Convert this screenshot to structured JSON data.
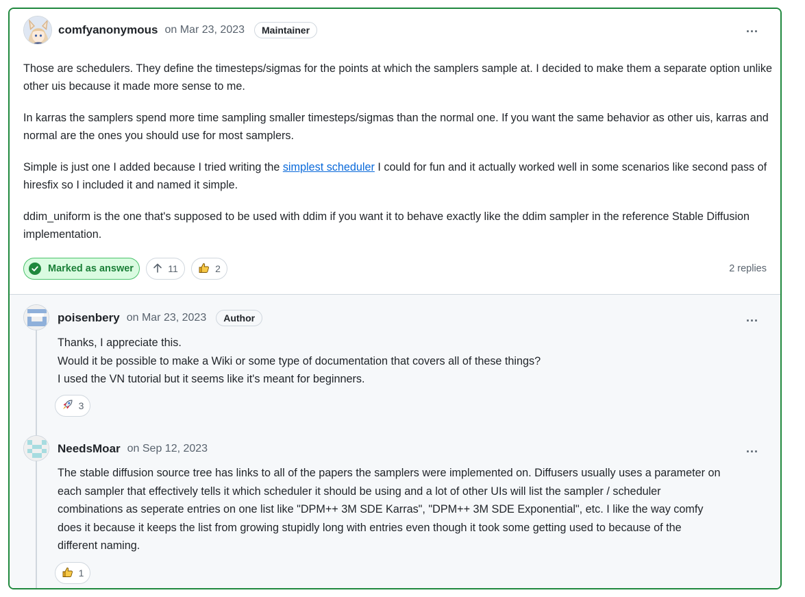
{
  "main_comment": {
    "author": "comfyanonymous",
    "date": "on Mar 23, 2023",
    "role_badge": "Maintainer",
    "paragraphs": {
      "p1": "Those are schedulers. They define the timesteps/sigmas for the points at which the samplers sample at. I decided to make them a separate option unlike other uis because it made more sense to me.",
      "p2": "In karras the samplers spend more time sampling smaller timesteps/sigmas than the normal one. If you want the same behavior as other uis, karras and normal are the ones you should use for most samplers.",
      "p3_before": "Simple is just one I added because I tried writing the ",
      "p3_link": "simplest scheduler",
      "p3_after": " I could for fun and it actually worked well in some scenarios like second pass of hiresfix so I included it and named it simple.",
      "p4": "ddim_uniform is the one that's supposed to be used with ddim if you want it to behave exactly like the ddim sampler in the reference Stable Diffusion implementation."
    },
    "marked_answer_label": "Marked as answer",
    "upvote_count": "11",
    "thumbs_up_count": "2",
    "replies_label": "2 replies",
    "more_icon": "..."
  },
  "replies": [
    {
      "author": "poisenbery",
      "date": "on Mar 23, 2023",
      "role_badge": "Author",
      "lines": [
        "Thanks, I appreciate this.",
        "Would it be possible to make a Wiki or some type of documentation that covers all of these things?",
        "I used the VN tutorial but it seems like it's meant for beginners."
      ],
      "reaction_icon": "rocket-icon",
      "reaction_count": "3",
      "more_icon": "..."
    },
    {
      "author": "NeedsMoar",
      "date": "on Sep 12, 2023",
      "lines": [
        "The stable diffusion source tree has links to all of the papers the samplers were implemented on. Diffusers usually uses a parameter on",
        "each sampler that effectively tells it which scheduler it should be using and a lot of other UIs will list the sampler / scheduler",
        "combinations as seperate entries on one list like \"DPM++ 3M SDE Karras\", \"DPM++ 3M SDE Exponential\", etc. I like the way comfy",
        "does it because it keeps the list from growing stupidly long with entries even though it took some getting used to because of the",
        "different naming."
      ],
      "reaction_icon": "thumbs-up-icon",
      "reaction_count": "1",
      "more_icon": "..."
    }
  ],
  "colors": {
    "answer_border": "#1f883d",
    "link": "#0969da",
    "reply_background": "#f6f8fa"
  }
}
